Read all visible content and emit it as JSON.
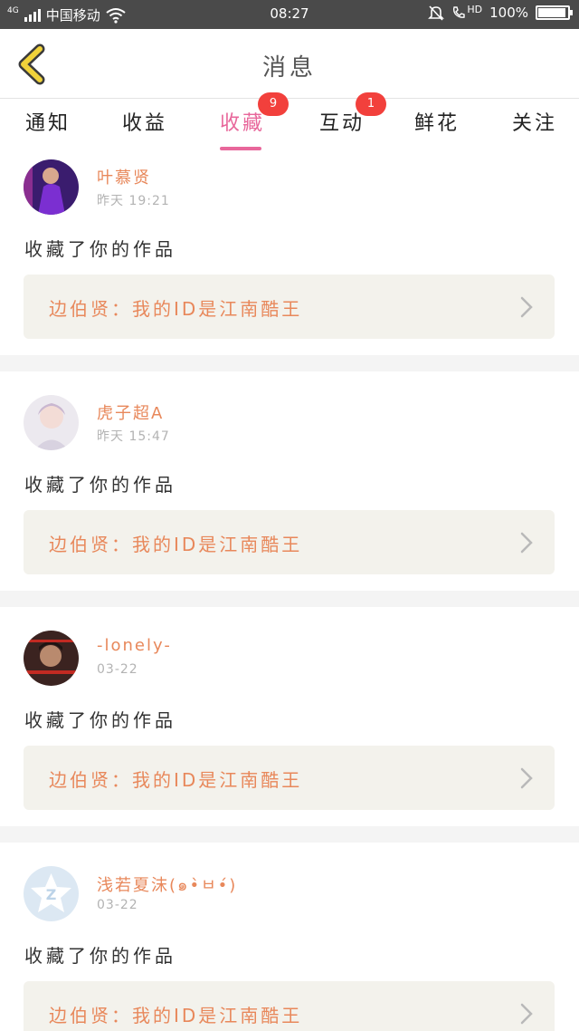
{
  "status_bar": {
    "network_type": "4G",
    "carrier": "中国移动",
    "time": "08:27",
    "hd_label": "HD",
    "battery": "100%",
    "battery_level": 1.0,
    "icons": [
      "signal-icon",
      "wifi-icon",
      "bell-off-icon",
      "hd-call-icon",
      "battery-icon"
    ]
  },
  "header": {
    "title": "消息",
    "back_icon": "chevron-left-icon",
    "back_icon_color": "#f0d23a"
  },
  "tabs": [
    {
      "label": "通知",
      "badge": ""
    },
    {
      "label": "收益",
      "badge": ""
    },
    {
      "label": "收藏",
      "badge": "9",
      "active": true
    },
    {
      "label": "互动",
      "badge": "1"
    },
    {
      "label": "鲜花",
      "badge": ""
    },
    {
      "label": "关注",
      "badge": ""
    }
  ],
  "colors": {
    "accent": "#e8679b",
    "username": "#e8885b",
    "badge": "#f2403c",
    "link_bg": "#f3f2ec"
  },
  "feed": [
    {
      "user": "叶慕贤",
      "time": "昨天 19:21",
      "action": "收藏了你的作品",
      "work": "边伯贤：我的ID是江南酷王"
    },
    {
      "user": "虎子超A",
      "time": "昨天 15:47",
      "action": "收藏了你的作品",
      "work": "边伯贤：我的ID是江南酷王"
    },
    {
      "user": "-lonely-",
      "time": "03-22",
      "action": "收藏了你的作品",
      "work": "边伯贤：我的ID是江南酷王"
    },
    {
      "user": "浅若夏沫(๑•̀ㅂ•́)",
      "time": "03-22",
      "action": "收藏了你的作品",
      "work": "边伯贤：我的ID是江南酷王"
    }
  ]
}
